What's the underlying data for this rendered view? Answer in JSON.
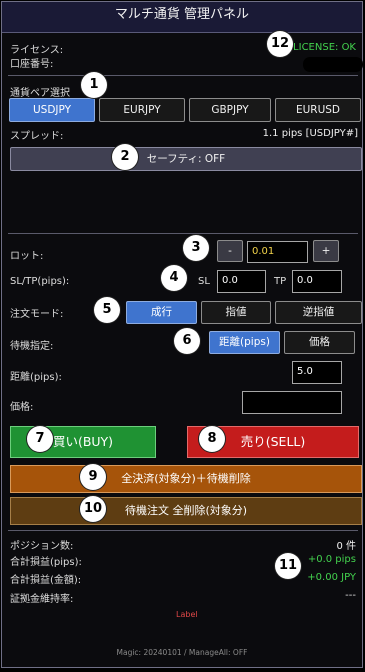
{
  "title": "マルチ通貨 管理パネル",
  "license": {
    "label": "ライセンス:",
    "status": "LICENSE: OK"
  },
  "account": {
    "label": "口座番号:"
  },
  "pair_select": {
    "label": "通貨ペア選択",
    "pairs": [
      "USDJPY",
      "EURJPY",
      "GBPJPY",
      "EURUSD"
    ]
  },
  "spread": {
    "label": "スプレッド:",
    "value": "1.1 pips [USDJPY#]"
  },
  "safety": {
    "label": "セーフティ: OFF"
  },
  "lot": {
    "label": "ロット:",
    "minus": "-",
    "value": "0.01",
    "plus": "+"
  },
  "sltp": {
    "label": "SL/TP(pips):",
    "sl_label": "SL",
    "sl_value": "0.0",
    "tp_label": "TP",
    "tp_value": "0.0"
  },
  "order_mode": {
    "label": "注文モード:",
    "options": [
      "成行",
      "指値",
      "逆指値"
    ]
  },
  "pending": {
    "label": "待機指定:",
    "options": [
      "距離(pips)",
      "価格"
    ]
  },
  "distance": {
    "label": "距離(pips):",
    "value": "5.0"
  },
  "price": {
    "label": "価格:",
    "value": ""
  },
  "buy_button": "買い(BUY)",
  "sell_button": "売り(SELL)",
  "close_all_button": "全決済(対象分)＋待機削除",
  "delete_pending_button": "待機注文 全削除(対象分)",
  "stats": {
    "positions_label": "ポジション数:",
    "positions_value": "0 件",
    "pips_label": "合計損益(pips):",
    "pips_value": "+0.0 pips",
    "amount_label": "合計損益(金額):",
    "amount_value": "+0.00 JPY",
    "margin_label": "証拠金維持率:",
    "margin_value": "---"
  },
  "label_text": "Label",
  "footer": "Magic: 20240101 / ManageAll: OFF",
  "badges": [
    "1",
    "2",
    "3",
    "4",
    "5",
    "6",
    "7",
    "8",
    "9",
    "10",
    "11",
    "12"
  ],
  "colors": {
    "blue": "#3f74ce",
    "green": "#1f9233",
    "red": "#c41c1c",
    "orange": "#a6540a",
    "brown": "#5e3d12",
    "ok": "#43d14e"
  }
}
